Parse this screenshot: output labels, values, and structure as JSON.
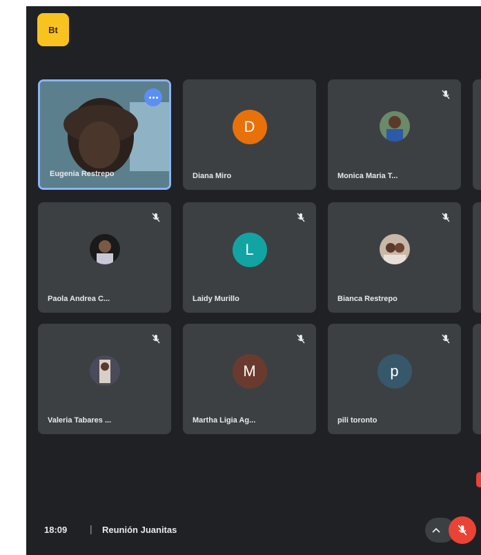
{
  "app": {
    "logo_text": "Bt"
  },
  "participants": [
    {
      "name": "Eugenia Restrepo",
      "type": "video",
      "self": true
    },
    {
      "name": "Diana Miro",
      "type": "letter",
      "letter": "D",
      "color": "#e8710a"
    },
    {
      "name": "Monica Maria T...",
      "type": "photo"
    },
    {
      "name": "Paola Andrea C...",
      "type": "photo"
    },
    {
      "name": "Laidy Murillo",
      "type": "letter",
      "letter": "L",
      "color": "#12a4a3"
    },
    {
      "name": "Bianca Restrepo",
      "type": "photo"
    },
    {
      "name": "Valeria Tabares ...",
      "type": "photo"
    },
    {
      "name": "Martha Ligia Ag...",
      "type": "letter",
      "letter": "M",
      "color": "#6b3a2e"
    },
    {
      "name": "pili toronto",
      "type": "letter",
      "letter": "p",
      "color": "#37576a"
    }
  ],
  "footer": {
    "time": "18:09",
    "separator": "|",
    "meeting_title": "Reunión Juanitas"
  },
  "colors": {
    "background": "#202124",
    "tile": "#3c4043",
    "mic_off": "#ea4335",
    "logo": "#f9c31f"
  },
  "icons": {
    "mute": "mic-off-icon",
    "more": "more-options-icon",
    "chevron": "chevron-up-icon"
  }
}
